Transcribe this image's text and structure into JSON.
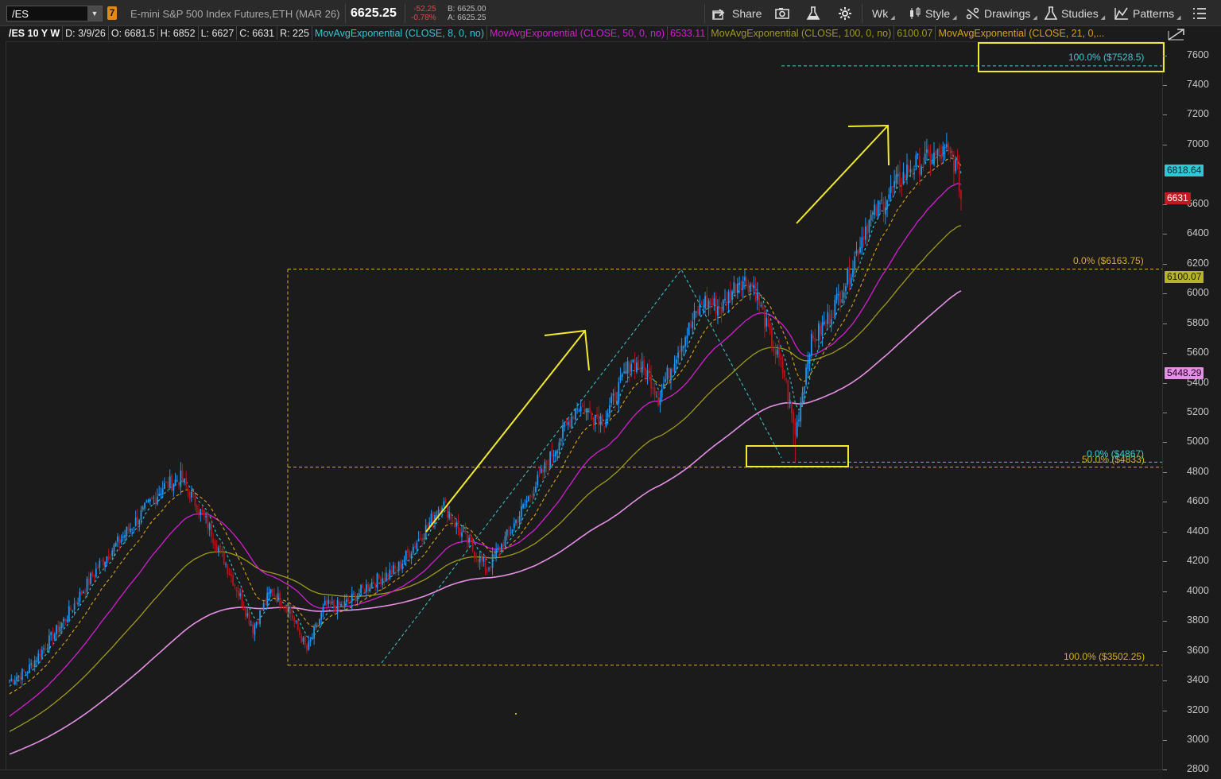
{
  "toolbar": {
    "symbol": "/ES",
    "link_number": "7",
    "description": "E-mini S&P 500 Index Futures,ETH (MAR 26)",
    "last_price": "6625.25",
    "net_change": "-52.25",
    "pct_change": "-0.78%",
    "bid": "B: 6625.00",
    "ask": "A: 6625.25",
    "share_label": "Share",
    "timeframe_label": "Wk",
    "style_label": "Style",
    "drawings_label": "Drawings",
    "studies_label": "Studies",
    "patterns_label": "Patterns"
  },
  "study_header": {
    "chart_id": "/ES 10 Y W",
    "date": "D: 3/9/26",
    "open": "O: 6681.5",
    "high": "H: 6852",
    "low": "L: 6627",
    "close": "C: 6631",
    "range": "R: 225",
    "ema8": "MovAvgExponential (CLOSE, 8, 0, no)",
    "ema50": "MovAvgExponential (CLOSE, 50, 0, no)",
    "ema50_value": "6533.11",
    "ema100": "MovAvgExponential (CLOSE, 100, 0, no)",
    "ema100_value": "6100.07",
    "ema21": "MovAvgExponential (CLOSE, 21, 0,..."
  },
  "colors": {
    "ema8": "#33c7d4",
    "ema21": "#d9a21a",
    "ema50": "#d21fd2",
    "ema100": "#9e9a1c",
    "ema200": "#e58fe6",
    "up_candle": "#1f96f0",
    "down_candle": "#b8121b",
    "fib_gold": "#d8b022",
    "fib_cyan": "#3ec9d1",
    "annotation_yellow": "#f2ea2c"
  },
  "price_tags": [
    {
      "value": "6818.64",
      "color": "#33c7d4",
      "text_color": "#0b1f24"
    },
    {
      "value": "6631",
      "color": "#c21820",
      "text_color": "#ffffff"
    },
    {
      "value": "6100.07",
      "color": "#b8b42a",
      "text_color": "#1a1a00"
    },
    {
      "value": "5448.29",
      "color": "#e58fe6",
      "text_color": "#200020"
    }
  ],
  "fib_labels": {
    "gold_top": "0.0%  ($6163.75)",
    "gold_bottom": "100.0%  ($3502.25)",
    "gold_mid": "50.0%  ($4833)",
    "cyan_top": "100.0%  ($7528.5)",
    "cyan_bottom": "0.0%  ($4867)"
  },
  "chart_data": {
    "type": "candlestick",
    "timeframe": "weekly",
    "y_ticks": [
      2800,
      3000,
      3200,
      3400,
      3600,
      3800,
      4000,
      4200,
      4400,
      4600,
      4800,
      5000,
      5200,
      5400,
      5600,
      5800,
      6000,
      6200,
      6400,
      6600,
      7000,
      7200,
      7400,
      7600
    ],
    "ylim": [
      2790,
      7640
    ],
    "close_anchors": [
      [
        0,
        3400
      ],
      [
        10,
        3470
      ],
      [
        30,
        3800
      ],
      [
        50,
        4180
      ],
      [
        70,
        4470
      ],
      [
        85,
        4700
      ],
      [
        95,
        4760
      ],
      [
        110,
        4450
      ],
      [
        125,
        4050
      ],
      [
        135,
        3750
      ],
      [
        145,
        4000
      ],
      [
        155,
        3880
      ],
      [
        165,
        3600
      ],
      [
        175,
        3900
      ],
      [
        185,
        3900
      ],
      [
        200,
        4050
      ],
      [
        215,
        4150
      ],
      [
        230,
        4400
      ],
      [
        240,
        4600
      ],
      [
        250,
        4400
      ],
      [
        265,
        4150
      ],
      [
        280,
        4450
      ],
      [
        295,
        4780
      ],
      [
        315,
        5250
      ],
      [
        330,
        5150
      ],
      [
        345,
        5550
      ],
      [
        355,
        5450
      ],
      [
        360,
        5300
      ],
      [
        370,
        5600
      ],
      [
        385,
        5950
      ],
      [
        395,
        5900
      ],
      [
        405,
        6100
      ],
      [
        413,
        6050
      ],
      [
        422,
        5700
      ],
      [
        430,
        5450
      ],
      [
        436,
        5050
      ],
      [
        444,
        5650
      ],
      [
        455,
        5850
      ],
      [
        465,
        6100
      ],
      [
        475,
        6450
      ],
      [
        490,
        6700
      ],
      [
        500,
        6850
      ],
      [
        510,
        6900
      ],
      [
        520,
        6950
      ],
      [
        525,
        6860
      ],
      [
        528,
        6680
      ]
    ],
    "fib_gold": {
      "high": 6163.75,
      "low": 3502.25,
      "mid": 4833,
      "high_label": "0.0%",
      "low_label": "100.0%",
      "mid_label": "50.0%"
    },
    "fib_cyan": {
      "high": 7528.5,
      "low": 4867,
      "high_label": "100.0%",
      "low_label": "0.0%"
    },
    "last_price": 6631
  }
}
